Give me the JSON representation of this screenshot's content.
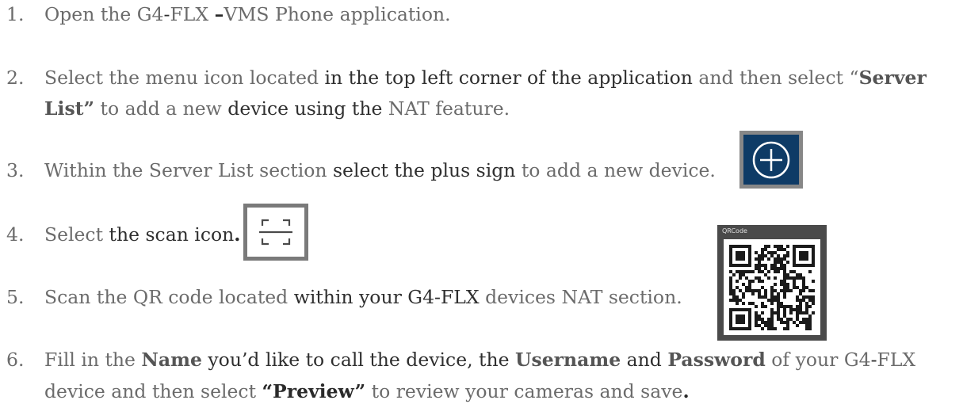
{
  "steps": [
    {
      "num": "1.",
      "lines": [
        [
          {
            "t": "Open the G4",
            "s": ""
          },
          {
            "t": "-",
            "s": "dk"
          },
          {
            "t": "FLX ",
            "s": ""
          },
          {
            "t": "–",
            "s": "bk"
          },
          {
            "t": "VMS Phone ",
            "s": ""
          },
          {
            "t": "application.",
            "s": ""
          }
        ]
      ]
    },
    {
      "num": "2.",
      "lines": [
        [
          {
            "t": "Select the menu icon located ",
            "s": ""
          },
          {
            "t": "in the top left corner of the application ",
            "s": "dk"
          },
          {
            "t": "and then select “",
            "s": ""
          },
          {
            "t": "Server",
            "s": "b"
          }
        ],
        [
          {
            "t": "List”",
            "s": "b"
          },
          {
            "t": " to add a new ",
            "s": ""
          },
          {
            "t": "device using the ",
            "s": "dk"
          },
          {
            "t": "NAT feature.",
            "s": ""
          }
        ]
      ]
    },
    {
      "num": "3.",
      "lines": [
        [
          {
            "t": "Within the Server List section ",
            "s": ""
          },
          {
            "t": "select the plus sign ",
            "s": "dk"
          },
          {
            "t": "to add a new device.",
            "s": ""
          }
        ]
      ]
    },
    {
      "num": "4.",
      "lines": [
        [
          {
            "t": "Select ",
            "s": ""
          },
          {
            "t": "the scan icon",
            "s": "dk"
          },
          {
            "t": ".",
            "s": "bk"
          }
        ]
      ]
    },
    {
      "num": "5.",
      "lines": [
        [
          {
            "t": "Scan the QR code located ",
            "s": ""
          },
          {
            "t": "within your G4",
            "s": "dk"
          },
          {
            "t": "-",
            "s": "dk"
          },
          {
            "t": "FLX ",
            "s": "dk"
          },
          {
            "t": "devices NAT section.",
            "s": ""
          }
        ]
      ]
    },
    {
      "num": "6.",
      "lines": [
        [
          {
            "t": "Fill in the ",
            "s": ""
          },
          {
            "t": "Name",
            "s": "b"
          },
          {
            "t": " you’d like to call the device, the ",
            "s": "dk"
          },
          {
            "t": "Username",
            "s": "b"
          },
          {
            "t": " and ",
            "s": "dk"
          },
          {
            "t": "Password",
            "s": "b"
          },
          {
            "t": " of your G4",
            "s": ""
          },
          {
            "t": "-",
            "s": "dk"
          },
          {
            "t": "FLX",
            "s": ""
          }
        ],
        [
          {
            "t": "device and then select ",
            "s": ""
          },
          {
            "t": "“Preview”",
            "s": "bk"
          },
          {
            "t": " to review your cameras and save",
            "s": ""
          },
          {
            "t": ".",
            "s": "bk"
          }
        ]
      ]
    }
  ],
  "icons": {
    "plus": {
      "name": "plus-circle-icon",
      "bg": "#0e3b66",
      "border": "#878787"
    },
    "scan": {
      "name": "scan-frame-icon",
      "border": "#7a7a7a"
    },
    "qr": {
      "name": "qr-code-image",
      "label": "QRCode"
    }
  }
}
